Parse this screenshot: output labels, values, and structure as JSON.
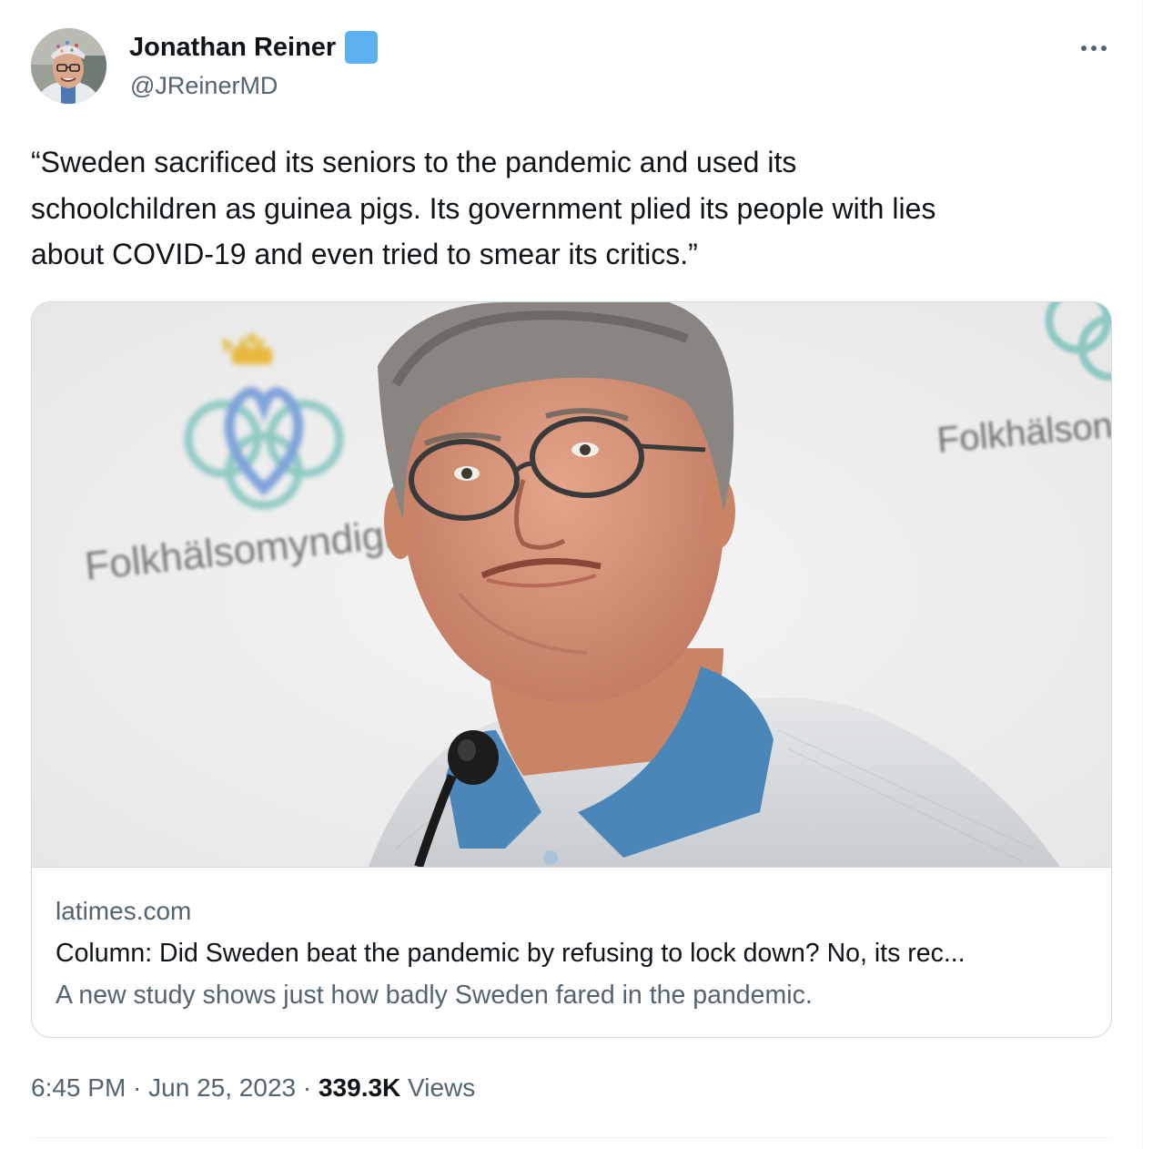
{
  "author": {
    "name": "Jonathan Reiner",
    "handle": "@JReinerMD",
    "verified_color": "#5bb0f0"
  },
  "tweet": {
    "text": "“Sweden sacrificed its seniors to the pandemic and used its\nschoolchildren as guinea pigs. Its government plied its people with lies\nabout COVID-19 and even tried to smear its critics.”"
  },
  "card": {
    "domain": "latimes.com",
    "title": "Column: Did Sweden beat the pandemic by refusing to lock down? No, its rec...",
    "description": "A new study shows just how badly Sweden fared in the pandemic.",
    "image_texts": {
      "left_logo_text": "Folkhälsomyndigh",
      "right_logo_text": "Folkhälson"
    }
  },
  "meta": {
    "time": "6:45 PM",
    "separator1": " · ",
    "date": "Jun 25, 2023",
    "separator2": " · ",
    "views_count": "339.3K",
    "views_label": " Views"
  },
  "icons": {
    "more": "more-dots-icon",
    "verified": "verified-badge-icon"
  },
  "colors": {
    "text_primary": "#0f1419",
    "text_secondary": "#536471",
    "border": "#cfd9de",
    "shirt_blue": "#4a86b8"
  }
}
